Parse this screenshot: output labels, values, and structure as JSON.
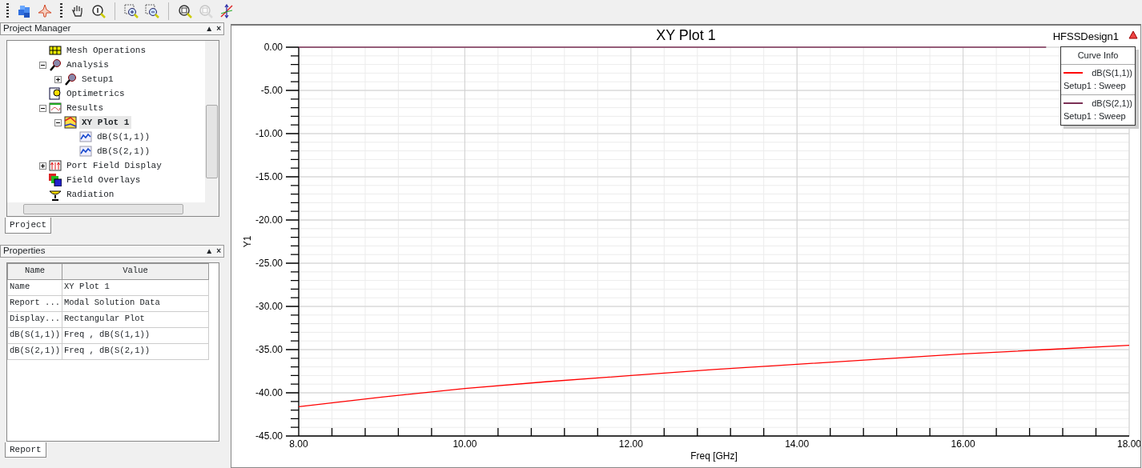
{
  "toolbar": [
    {
      "kind": "grip"
    },
    {
      "kind": "cubes",
      "disabled": false
    },
    {
      "kind": "aircraft",
      "disabled": false
    },
    {
      "kind": "grip"
    },
    {
      "kind": "hand",
      "disabled": false
    },
    {
      "kind": "info",
      "disabled": false
    },
    {
      "kind": "separator"
    },
    {
      "kind": "zoom-in",
      "disabled": false
    },
    {
      "kind": "zoom-out",
      "disabled": false
    },
    {
      "kind": "separator"
    },
    {
      "kind": "zoom-fit",
      "disabled": false
    },
    {
      "kind": "zoom-fit",
      "disabled": true
    },
    {
      "kind": "axes",
      "disabled": false
    }
  ],
  "project_manager": {
    "title": "Project Manager",
    "controls": [
      "▲",
      "×"
    ],
    "tab": "Project",
    "tree": [
      {
        "label": "Mesh Operations",
        "kind": "mesh",
        "selected": false
      },
      {
        "label": "Analysis",
        "kind": "analysis",
        "selected": false,
        "expanded": true,
        "children": [
          {
            "label": "Setup1",
            "kind": "analysis",
            "selected": false,
            "expanded": false
          }
        ]
      },
      {
        "label": "Optimetrics",
        "kind": "optimetrics",
        "selected": false
      },
      {
        "label": "Results",
        "kind": "results",
        "selected": false,
        "expanded": true,
        "children": [
          {
            "label": "XY Plot 1",
            "kind": "plot",
            "selected": true,
            "expanded": true,
            "children": [
              {
                "label": "dB(S(1,1))",
                "kind": "trace",
                "selected": false
              },
              {
                "label": "dB(S(2,1))",
                "kind": "trace",
                "selected": false
              }
            ]
          }
        ]
      },
      {
        "label": "Port Field Display",
        "kind": "port",
        "selected": false,
        "expanded": false
      },
      {
        "label": "Field Overlays",
        "kind": "overlays",
        "selected": false
      },
      {
        "label": "Radiation",
        "kind": "radiation",
        "selected": false
      }
    ]
  },
  "properties": {
    "title": "Properties",
    "controls": [
      "▲",
      "×"
    ],
    "tab": "Report",
    "columns": [
      "Name",
      "Value"
    ],
    "rows": [
      [
        "Name",
        "XY Plot 1"
      ],
      [
        "Report ...",
        "Modal Solution Data"
      ],
      [
        "Display...",
        "Rectangular Plot"
      ],
      [
        "dB(S(1,1))",
        "Freq , dB(S(1,1))"
      ],
      [
        "dB(S(2,1))",
        "Freq , dB(S(2,1))"
      ]
    ]
  },
  "plot": {
    "design": "HFSSDesign1",
    "legend": {
      "title": "Curve Info",
      "entries": [
        {
          "solution": "Setup1 : Sweep"
        },
        {
          "solution": "Setup1 : Sweep"
        }
      ]
    },
    "chart_data": {
      "type": "line",
      "title": "XY Plot 1",
      "xlabel": "Freq [GHz]",
      "ylabel": "Y1",
      "grid": true,
      "x": [
        8,
        9,
        10,
        11,
        12,
        13,
        14,
        15,
        16,
        17,
        18
      ],
      "series": [
        {
          "name": "dB(S(1,1))",
          "color": "#ff0000",
          "values": [
            -41.6,
            -40.5,
            -39.5,
            -38.7,
            -38.0,
            -37.3,
            -36.7,
            -36.1,
            -35.5,
            -35.0,
            -34.5
          ]
        },
        {
          "name": "dB(S(2,1))",
          "color": "#7b3055",
          "values": [
            0,
            0,
            0,
            0,
            0,
            0,
            0,
            0,
            0,
            0,
            null
          ]
        }
      ],
      "xlim": [
        8,
        18
      ],
      "ylim": [
        -45,
        0
      ],
      "xticks": [
        {
          "value": 8,
          "label": "8.00"
        },
        {
          "value": 10,
          "label": "10.00"
        },
        {
          "value": 12,
          "label": "12.00"
        },
        {
          "value": 14,
          "label": "14.00"
        },
        {
          "value": 16,
          "label": "16.00"
        },
        {
          "value": 18,
          "label": "18.00"
        }
      ],
      "yticks": [
        {
          "value": 0,
          "label": "0.00"
        },
        {
          "value": -5,
          "label": "-5.00"
        },
        {
          "value": -10,
          "label": "-10.00"
        },
        {
          "value": -15,
          "label": "-15.00"
        },
        {
          "value": -20,
          "label": "-20.00"
        },
        {
          "value": -25,
          "label": "-25.00"
        },
        {
          "value": -30,
          "label": "-30.00"
        },
        {
          "value": -35,
          "label": "-35.00"
        },
        {
          "value": -40,
          "label": "-40.00"
        },
        {
          "value": -45,
          "label": "-45.00"
        }
      ]
    }
  }
}
